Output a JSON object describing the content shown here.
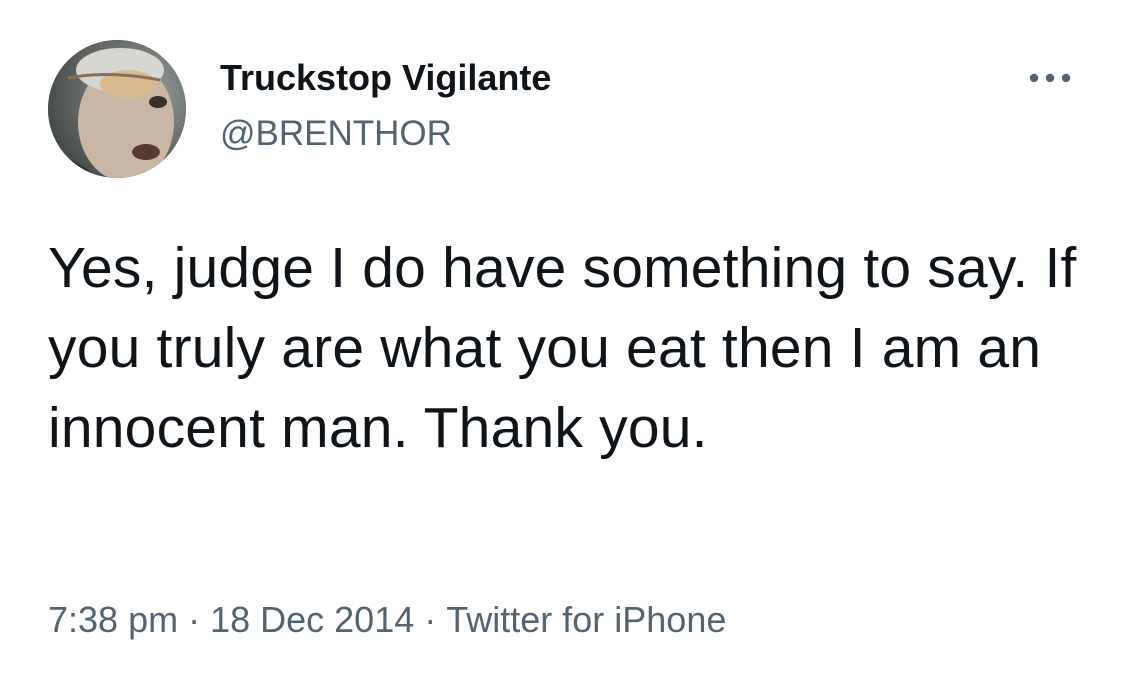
{
  "author": {
    "display_name": "Truckstop Vigilante",
    "handle": "@BRENTHOR",
    "avatar_icon": "avatar-photo"
  },
  "tweet": {
    "text": "Yes, judge I do have something to say. If you truly are what you eat then I am an innocent man. Thank you."
  },
  "meta": {
    "time": "7:38 pm",
    "separator": "·",
    "date": "18 Dec 2014",
    "source": "Twitter for iPhone"
  },
  "icons": {
    "more": "more-options-icon"
  },
  "colors": {
    "text_primary": "#0f1419",
    "text_secondary": "#536471",
    "background": "#ffffff"
  }
}
